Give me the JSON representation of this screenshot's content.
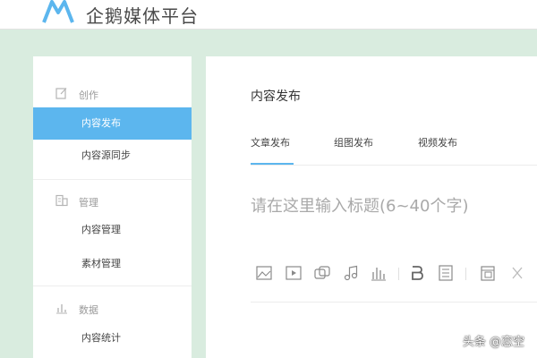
{
  "app": {
    "brand_name": "企鹅媒体平台",
    "logo_icon": "penguin-logo-icon"
  },
  "colors": {
    "accent": "#5cb6ee",
    "background": "#d9ecdf"
  },
  "sidebar": {
    "sections": [
      {
        "label": "创作",
        "icon": "edit-icon",
        "items": [
          {
            "label": "内容发布",
            "active": true
          },
          {
            "label": "内容源同步",
            "active": false
          }
        ]
      },
      {
        "label": "管理",
        "icon": "manage-icon",
        "items": [
          {
            "label": "内容管理",
            "active": false
          },
          {
            "label": "素材管理",
            "active": false
          }
        ]
      },
      {
        "label": "数据",
        "icon": "stats-icon",
        "items": [
          {
            "label": "内容统计",
            "active": false
          }
        ]
      }
    ]
  },
  "main": {
    "page_title": "内容发布",
    "tabs": [
      {
        "label": "文章发布",
        "active": true
      },
      {
        "label": "组图发布",
        "active": false
      },
      {
        "label": "视频发布",
        "active": false
      }
    ],
    "title_placeholder": "请在这里输入标题(6~40个字)",
    "toolbar": [
      "image-icon",
      "video-icon",
      "gallery-icon",
      "music-icon",
      "chart-icon",
      "bold-icon",
      "paragraph-icon",
      "template-icon",
      "cut-icon"
    ]
  },
  "watermark": "头条 @恋空"
}
